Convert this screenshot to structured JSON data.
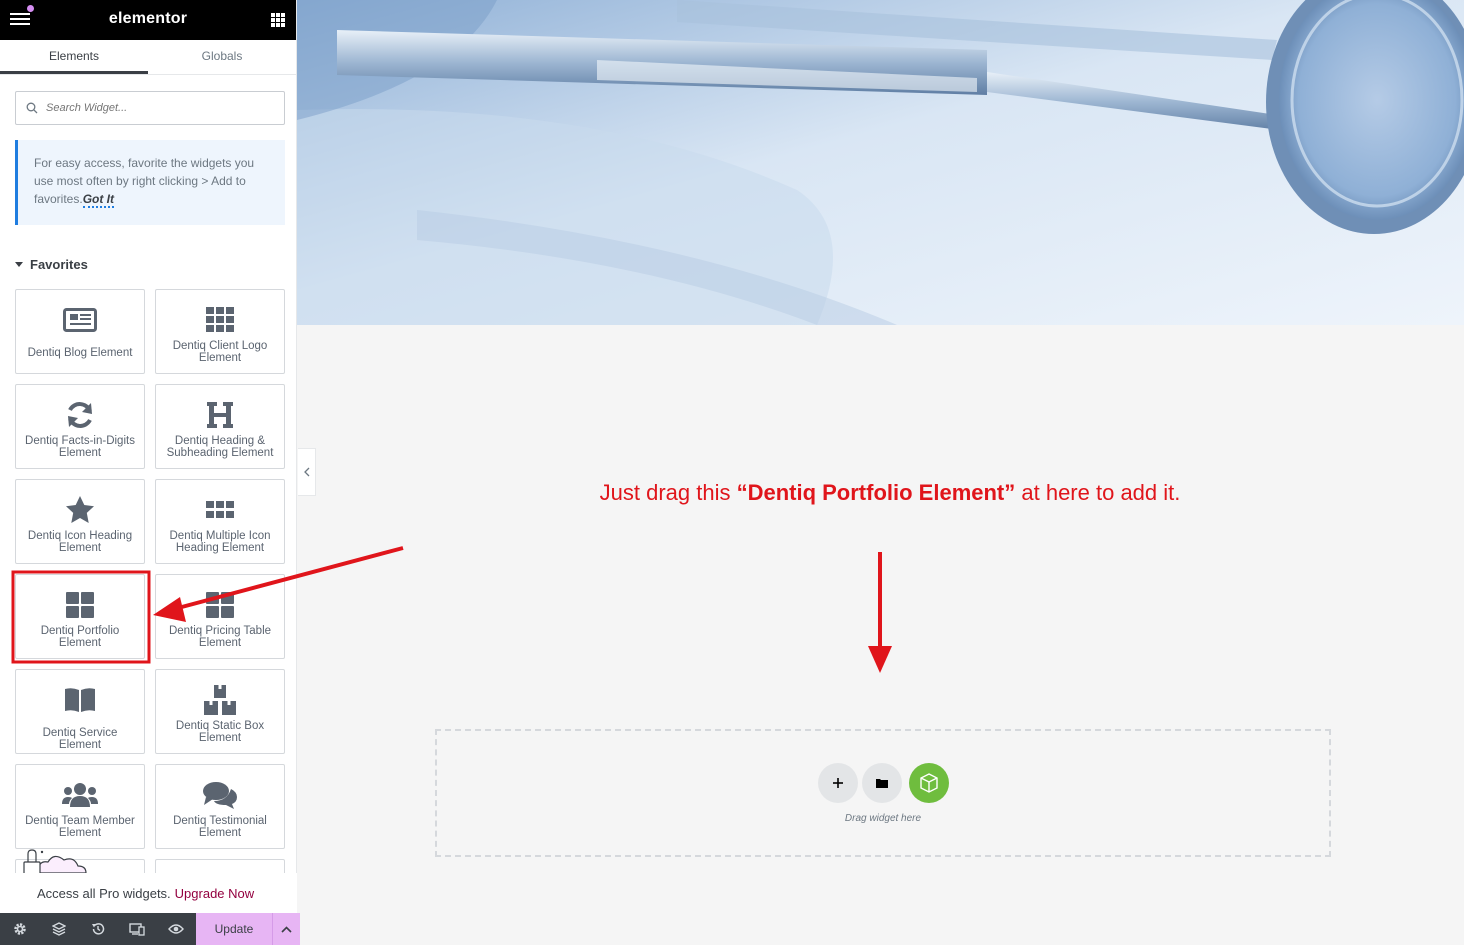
{
  "header": {
    "logo": "elementor"
  },
  "tabs": [
    {
      "label": "Elements"
    },
    {
      "label": "Globals"
    }
  ],
  "search": {
    "placeholder": "Search Widget..."
  },
  "tip": {
    "text": "For easy access, favorite the widgets you use most often by right clicking > Add to favorites.",
    "link": "Got It"
  },
  "favorites": {
    "title": "Favorites",
    "widgets": [
      {
        "label": "Dentiq Blog Element",
        "icon": "newspaper-icon"
      },
      {
        "label": "Dentiq Client Logo Element",
        "icon": "grid-nine-icon"
      },
      {
        "label": "Dentiq Facts-in-Digits Element",
        "icon": "refresh-icon"
      },
      {
        "label": "Dentiq Heading & Subheading Element",
        "icon": "heading-h-icon"
      },
      {
        "label": "Dentiq Icon Heading Element",
        "icon": "star-icon"
      },
      {
        "label": "Dentiq Multiple Icon Heading Element",
        "icon": "grid-six-icon"
      },
      {
        "label": "Dentiq Portfolio Element",
        "icon": "grid-four-icon"
      },
      {
        "label": "Dentiq Pricing Table Element",
        "icon": "grid-four-icon"
      },
      {
        "label": "Dentiq Service Element",
        "icon": "book-open-icon"
      },
      {
        "label": "Dentiq Static Box Element",
        "icon": "boxes-icon"
      },
      {
        "label": "Dentiq Team Member Element",
        "icon": "users-icon"
      },
      {
        "label": "Dentiq Testimonial Element",
        "icon": "comments-icon"
      }
    ]
  },
  "pro": {
    "text": "Access all Pro widgets.",
    "link": "Upgrade Now"
  },
  "footer": {
    "update_label": "Update"
  },
  "canvas": {
    "instruction_before": "Just drag this ",
    "instruction_bold": "“Dentiq Portfolio Element”",
    "instruction_after": " at here to add it.",
    "drag_text": "Drag widget here"
  },
  "colors": {
    "accent_red": "#e0151b",
    "update_pink": "#e7b5f4",
    "upgrade_link": "#93003f",
    "panel_dark": "#3a3f45"
  }
}
